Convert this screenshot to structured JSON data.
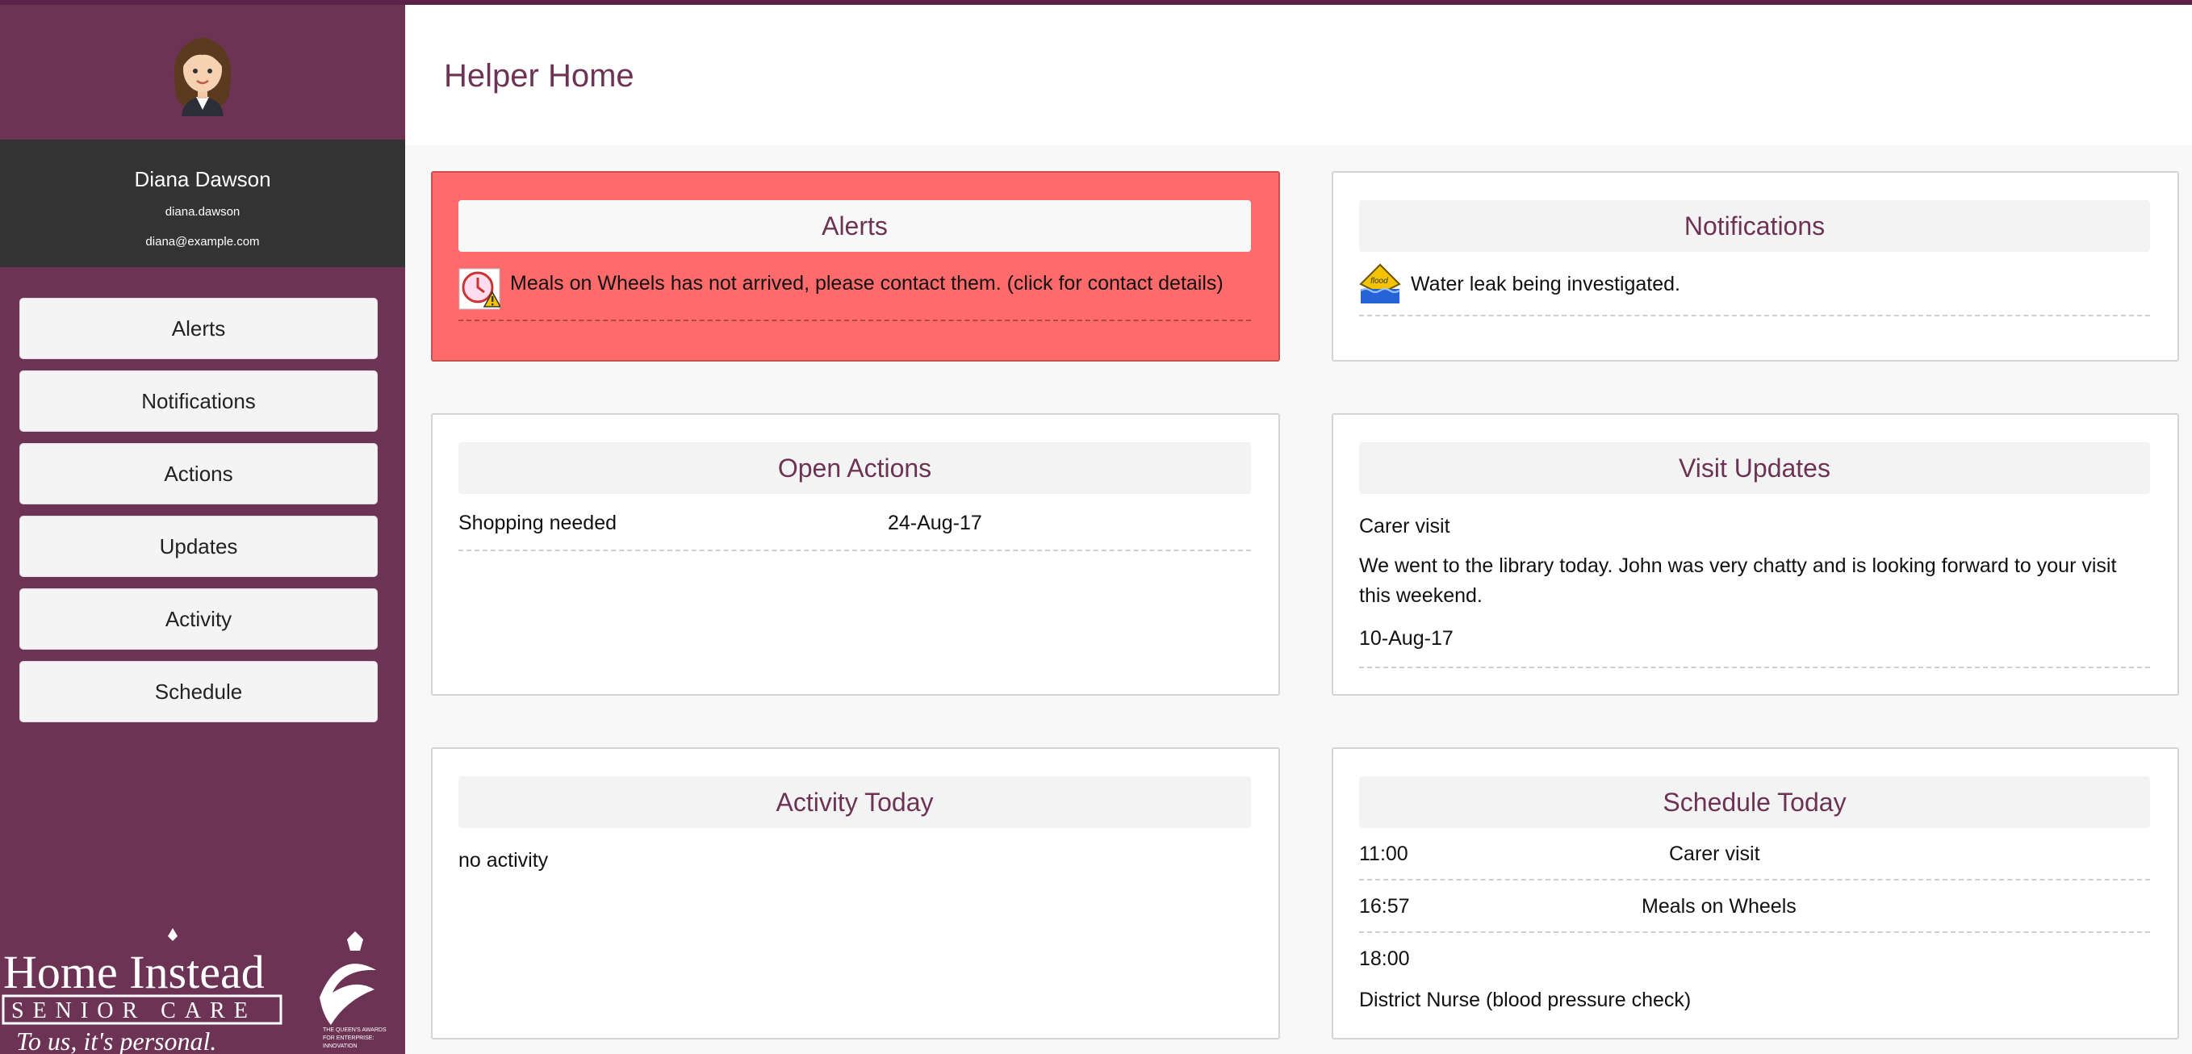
{
  "header": {
    "title": "Helper Home"
  },
  "user": {
    "name": "Diana Dawson",
    "login": "diana.dawson",
    "email": "diana@example.com"
  },
  "nav": {
    "items": [
      "Alerts",
      "Notifications",
      "Actions",
      "Updates",
      "Activity",
      "Schedule"
    ]
  },
  "alerts": {
    "title": "Alerts",
    "items": [
      {
        "icon": "clock-warning-icon",
        "text": "Meals on Wheels has not arrived, please contact them. (click for contact details)"
      }
    ]
  },
  "notifications": {
    "title": "Notifications",
    "items": [
      {
        "icon": "flood-warning-icon",
        "text": "Water leak being investigated."
      }
    ]
  },
  "open_actions": {
    "title": "Open Actions",
    "items": [
      {
        "text": "Shopping needed",
        "date": "24-Aug-17"
      }
    ]
  },
  "visit_updates": {
    "title": "Visit Updates",
    "items": [
      {
        "type": "Carer visit",
        "note": "We went to the library today. John was very chatty and is looking forward to your visit this weekend.",
        "date": "10-Aug-17"
      }
    ]
  },
  "activity_today": {
    "title": "Activity Today",
    "empty": "no activity"
  },
  "schedule_today": {
    "title": "Schedule Today",
    "items": [
      {
        "time": "11:00",
        "event": "Carer visit"
      },
      {
        "time": "16:57",
        "event": "Meals on Wheels"
      },
      {
        "time": "18:00",
        "event": "District Nurse (blood pressure check)"
      }
    ]
  },
  "logo": {
    "brand_line1": "Home Instead",
    "brand_line2": "SENIOR CARE",
    "tagline": "To us, it's personal.",
    "award": "THE QUEEN'S AWARDS FOR ENTERPRISE: INNOVATION"
  },
  "colors": {
    "brand": "#6d3355",
    "sidebar_user": "#333333",
    "alert_bg": "#ff6b6b"
  }
}
